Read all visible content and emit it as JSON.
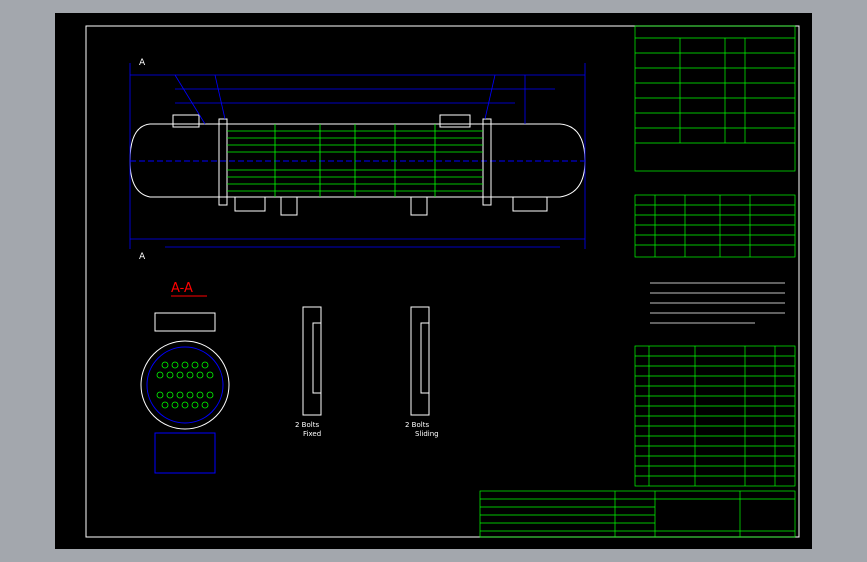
{
  "section": {
    "marker": "A",
    "title": "A-A"
  },
  "supports": {
    "fixed": {
      "bolts": "2  Bolts",
      "label": "Fixed"
    },
    "sliding": {
      "bolts": "2  Bolts",
      "label": "Sliding"
    }
  },
  "colors": {
    "background": "#000000",
    "frame": "#ffffff",
    "vessel": "#ffffff",
    "dimension": "#0000ff",
    "tubes": "#00ff00",
    "leader": "#0000ff",
    "section_title": "#ff0000",
    "table_grid": "#00ff00",
    "text": "#ffffff",
    "nozzle_symbol": "#ff0000"
  }
}
